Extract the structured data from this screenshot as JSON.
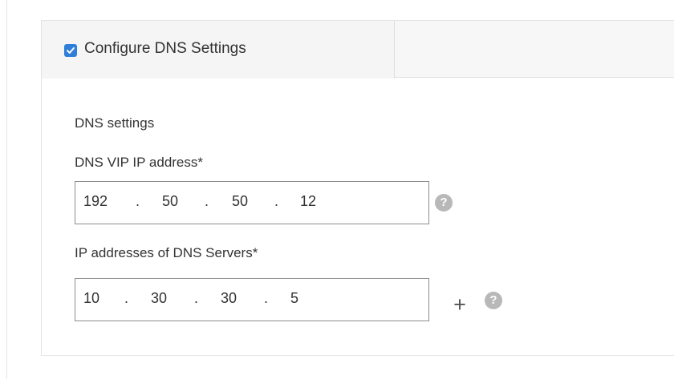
{
  "section": {
    "checkbox_checked": true,
    "checkbox_color": "#2f7fd8",
    "title": "Configure DNS Settings"
  },
  "form": {
    "group_label": "DNS settings",
    "vip": {
      "label": "DNS VIP IP address*",
      "octets": [
        "192",
        "50",
        "50",
        "12"
      ],
      "separator": "."
    },
    "servers": {
      "label": "IP addresses of DNS Servers*",
      "octets": [
        "10",
        "30",
        "30",
        "5"
      ],
      "separator": "."
    }
  },
  "icons": {
    "help": "?",
    "add": "+"
  }
}
